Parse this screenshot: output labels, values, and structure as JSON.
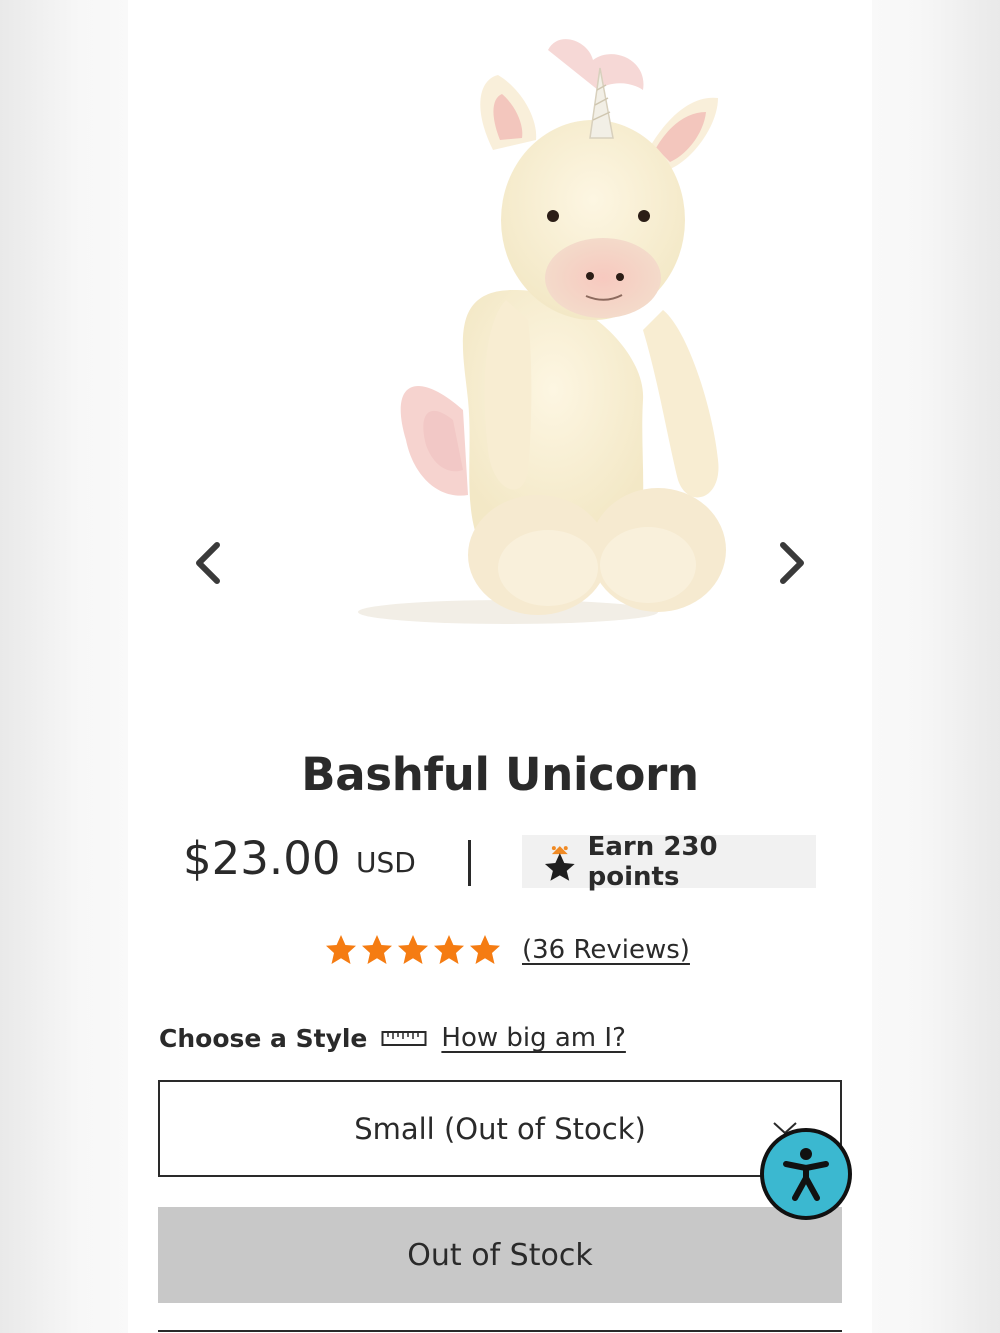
{
  "product": {
    "title": "Bashful Unicorn",
    "price": "$23.00",
    "currency": "USD",
    "points_badge": "Earn 230 points",
    "rating": {
      "stars": 5,
      "max": 5,
      "reviews_label": "(36 Reviews)"
    },
    "image_alt": "Bashful Unicorn plush toy"
  },
  "style_picker": {
    "label": "Choose a Style",
    "size_guide_link": "How big am I?",
    "selected_value": "Small (Out of Stock)"
  },
  "cta": {
    "label": "Out of Stock"
  },
  "icons": {
    "prev": "chevron-left-icon",
    "next": "chevron-right-icon",
    "points": "star-rewards-icon",
    "rating": "star-icon",
    "ruler": "ruler-icon",
    "dropdown": "chevron-down-icon",
    "accessibility": "accessibility-person-icon"
  },
  "colors": {
    "star": "#f57c12",
    "cta_background": "#c8c8c8",
    "badge_background": "#f1f1f1",
    "accessibility_widget": "#3bb8d0",
    "text": "#2a2a2a"
  }
}
